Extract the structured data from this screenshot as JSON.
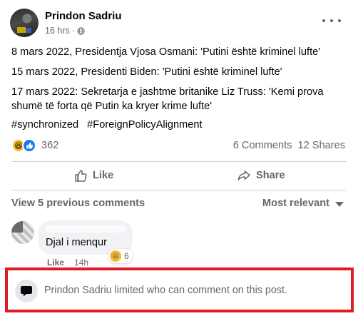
{
  "post": {
    "author": "Prindon Sadriu",
    "time": "16 hrs",
    "time_separator": "·",
    "audience_icon": "globe-icon",
    "paragraphs": [
      "8 mars 2022, Presidentja Vjosa Osmani: 'Putini është kriminel lufte'",
      "15 mars 2022, Presidenti Biden: 'Putini është kriminel lufte'",
      "17 mars 2022: Sekretarja e jashtme britanike Liz Truss: 'Kemi prova shumë të forta që Putin ka kryer krime lufte'"
    ],
    "hashtags": [
      "#synchronized",
      "#ForeignPolicyAlignment"
    ]
  },
  "reactions": {
    "icons": [
      "haha-reaction-icon",
      "like-reaction-icon"
    ],
    "count": "362",
    "comments": "6 Comments",
    "shares": "12 Shares"
  },
  "actions": {
    "like_label": "Like",
    "share_label": "Share"
  },
  "comments": {
    "view_previous": "View 5 previous comments",
    "sort_label": "Most relevant",
    "items": [
      {
        "text": "Djal i menqur",
        "reaction_count": "6",
        "like_label": "Like",
        "time": "14h"
      }
    ]
  },
  "notice": {
    "text": "Prindon Sadriu limited who can comment on this post."
  },
  "colors": {
    "secondary_text": "#65676b",
    "facebook_blue": "#1877f2",
    "highlight_border": "#e01b24"
  }
}
